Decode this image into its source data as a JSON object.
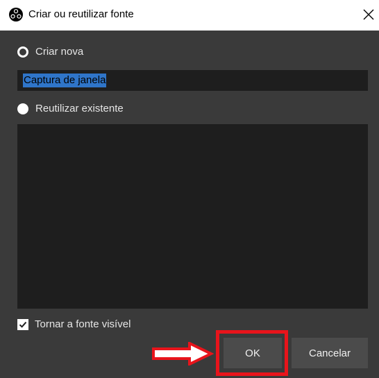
{
  "window": {
    "title": "Criar ou reutilizar fonte",
    "app_icon": "obs-logo-icon",
    "close_icon": "close-icon"
  },
  "options": {
    "create_new_label": "Criar nova",
    "create_new_selected": true,
    "reuse_existing_label": "Reutilizar existente",
    "reuse_existing_selected": false
  },
  "name_field": {
    "value": "Captura de janela"
  },
  "existing_sources": [],
  "visibility": {
    "label": "Tornar a fonte visível",
    "checked": true
  },
  "buttons": {
    "ok_label": "OK",
    "cancel_label": "Cancelar"
  },
  "annotations": {
    "highlight_color": "#e8141b"
  },
  "colors": {
    "dialog_background": "#3a3a3a",
    "field_background": "#1e1e1e",
    "selection": "#2f75c9",
    "button_background": "#4b4b4b"
  }
}
